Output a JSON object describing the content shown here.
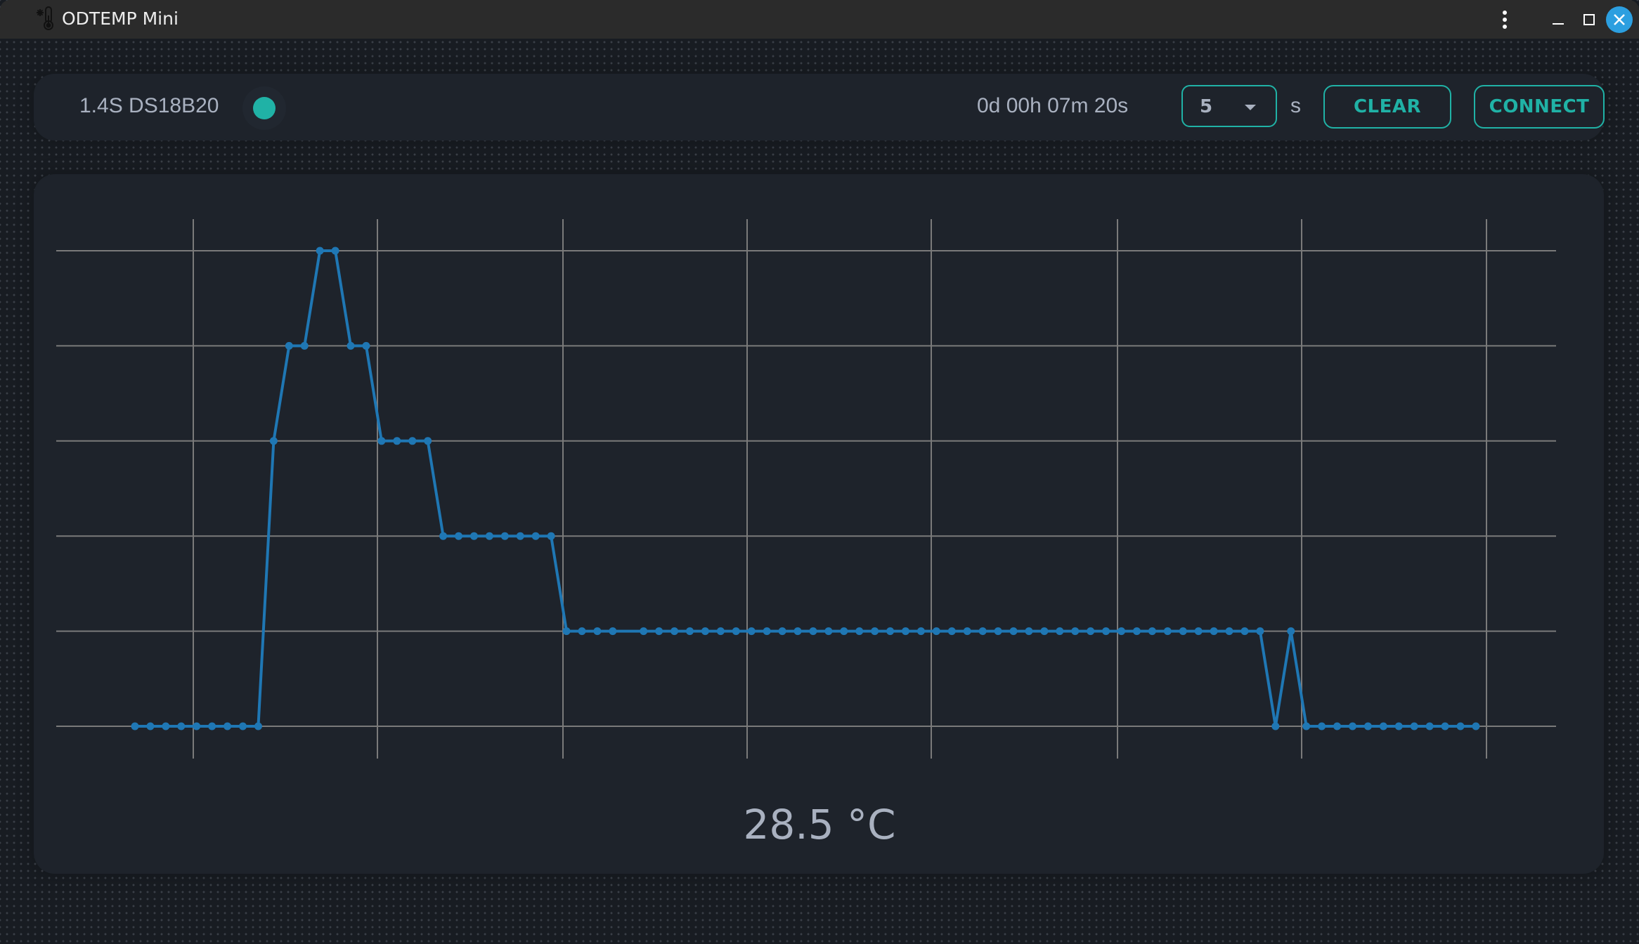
{
  "window": {
    "title": "ODTEMP Mini",
    "app_icon": "thermometer-snowflake-icon",
    "controls": [
      "more-options",
      "minimize",
      "maximize",
      "close"
    ]
  },
  "toolbar": {
    "device_label": "1.4S DS18B20",
    "status": "connected",
    "status_color": "#20b2a6",
    "uptime": "0d 00h 07m 20s",
    "interval_value": "5",
    "interval_unit": "s",
    "clear_label": "CLEAR",
    "connect_label": "CONNECT",
    "accent_color": "#20b2a6"
  },
  "readout": {
    "temperature": "28.5 °C"
  },
  "chart_data": {
    "type": "line",
    "title": "",
    "xlabel": "",
    "ylabel": "",
    "grid": true,
    "legend": "none",
    "series_color": "#1f77b4",
    "y_levels_note": "Y values expressed in grid steps (0 = lowest gridline, 5 = top gridline); no tick labels shown",
    "ylim": [
      0,
      5
    ],
    "x_count": 88,
    "series": [
      {
        "name": "temperature",
        "values": [
          0,
          0,
          0,
          0,
          0,
          0,
          0,
          0,
          0,
          3,
          4,
          4,
          5,
          5,
          4,
          4,
          3,
          3,
          3,
          3,
          2,
          2,
          2,
          2,
          2,
          2,
          2,
          2,
          1,
          1,
          1,
          1,
          null,
          1,
          1,
          1,
          1,
          1,
          1,
          1,
          1,
          1,
          1,
          1,
          1,
          1,
          1,
          1,
          1,
          1,
          1,
          1,
          1,
          1,
          1,
          1,
          1,
          1,
          1,
          1,
          1,
          1,
          1,
          1,
          1,
          1,
          1,
          1,
          1,
          1,
          1,
          1,
          1,
          1,
          0,
          1,
          0,
          0,
          0,
          0,
          0,
          0,
          0,
          0,
          0,
          0,
          0,
          0
        ]
      }
    ]
  }
}
